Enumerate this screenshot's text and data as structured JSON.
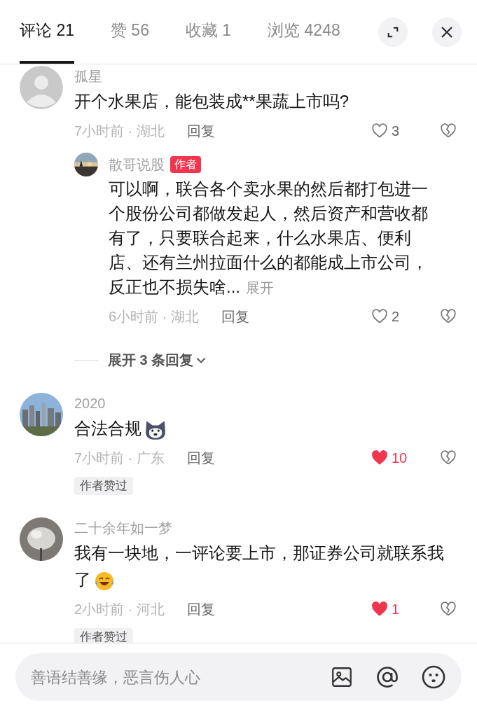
{
  "tabs": [
    {
      "label": "评论 21",
      "selected": true
    },
    {
      "label": "赞 56",
      "selected": false
    },
    {
      "label": "收藏 1",
      "selected": false
    },
    {
      "label": "浏览 4248",
      "selected": false
    }
  ],
  "comments": [
    {
      "name": "孤星",
      "avatar": {
        "kind": "silhouette"
      },
      "text": "开个水果店，能包装成**果蔬上市吗?",
      "meta": "7小时前 · 湖北",
      "reply_label": "回复",
      "likes": "3",
      "liked": false,
      "replies": [
        {
          "name": "散哥说股",
          "badge": "作者",
          "text": "可以啊，联合各个卖水果的然后都打包进一个股份公司都做发起人，然后资产和营收都有了，只要联合起来，什么水果店、便利店、还有兰州拉面什么的都能成上市公司，反正也不损失啥...",
          "more_label": "展开",
          "meta": "6小时前 · 湖北",
          "reply_label": "回复",
          "likes": "2",
          "liked": false
        }
      ],
      "expand_label": "展开 3 条回复"
    },
    {
      "name": "2020",
      "text": "合法合规",
      "sticker": {
        "kind": "husky"
      },
      "meta": "7小时前 · 广东",
      "reply_label": "回复",
      "likes": "10",
      "liked": true,
      "author_badge": "作者赞过"
    },
    {
      "name": "二十余年如一梦",
      "text": "我有一块地，一评论要上市，那证券公司就联系我了",
      "sticker": {
        "kind": "laughing"
      },
      "meta": "2小时前 · 河北",
      "reply_label": "回复",
      "likes": "1",
      "liked": true,
      "author_badge": "作者赞过"
    }
  ],
  "input": {
    "placeholder": "善语结善缘，恶言伤人心"
  }
}
